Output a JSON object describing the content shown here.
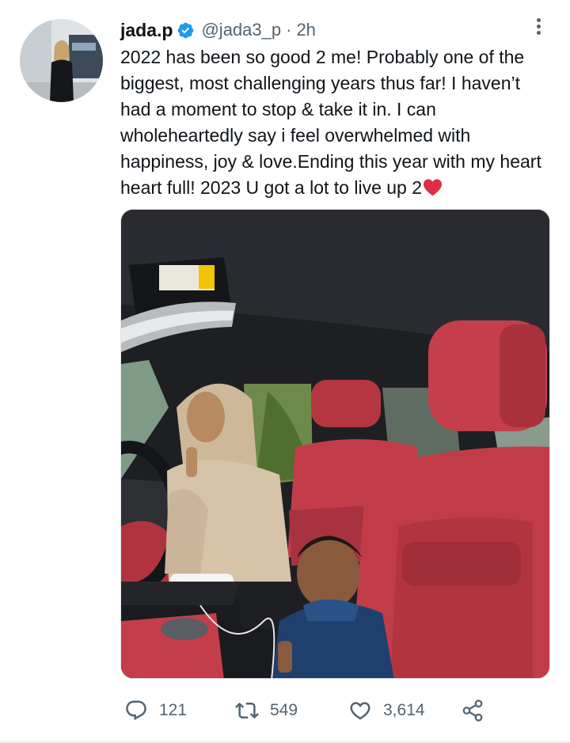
{
  "tweet": {
    "display_name": "jada.p",
    "handle": "@jada3_p",
    "separator": "·",
    "time": "2h",
    "text": "2022 has been so good 2 me! Probably one of the biggest, most challenging years thus far! I haven’t had a moment to stop & take it in. I can wholeheartedly say i feel overwhelmed with happiness, joy & love.Ending this year with my heart heart full! 2023 U got a lot to live up 2",
    "text_emoji": "red-heart-emoji"
  },
  "actions": {
    "reply_count": "121",
    "retweet_count": "549",
    "like_count": "3,614"
  },
  "icons": {
    "verified": "verified-badge-icon",
    "more": "more-vertical-icon",
    "reply": "reply-icon",
    "retweet": "retweet-icon",
    "like": "heart-icon",
    "share": "share-icon"
  },
  "colors": {
    "verified_blue": "#1d9bf0",
    "text_primary": "#0f1419",
    "text_secondary": "#536471",
    "heart_red": "#e0245e"
  }
}
